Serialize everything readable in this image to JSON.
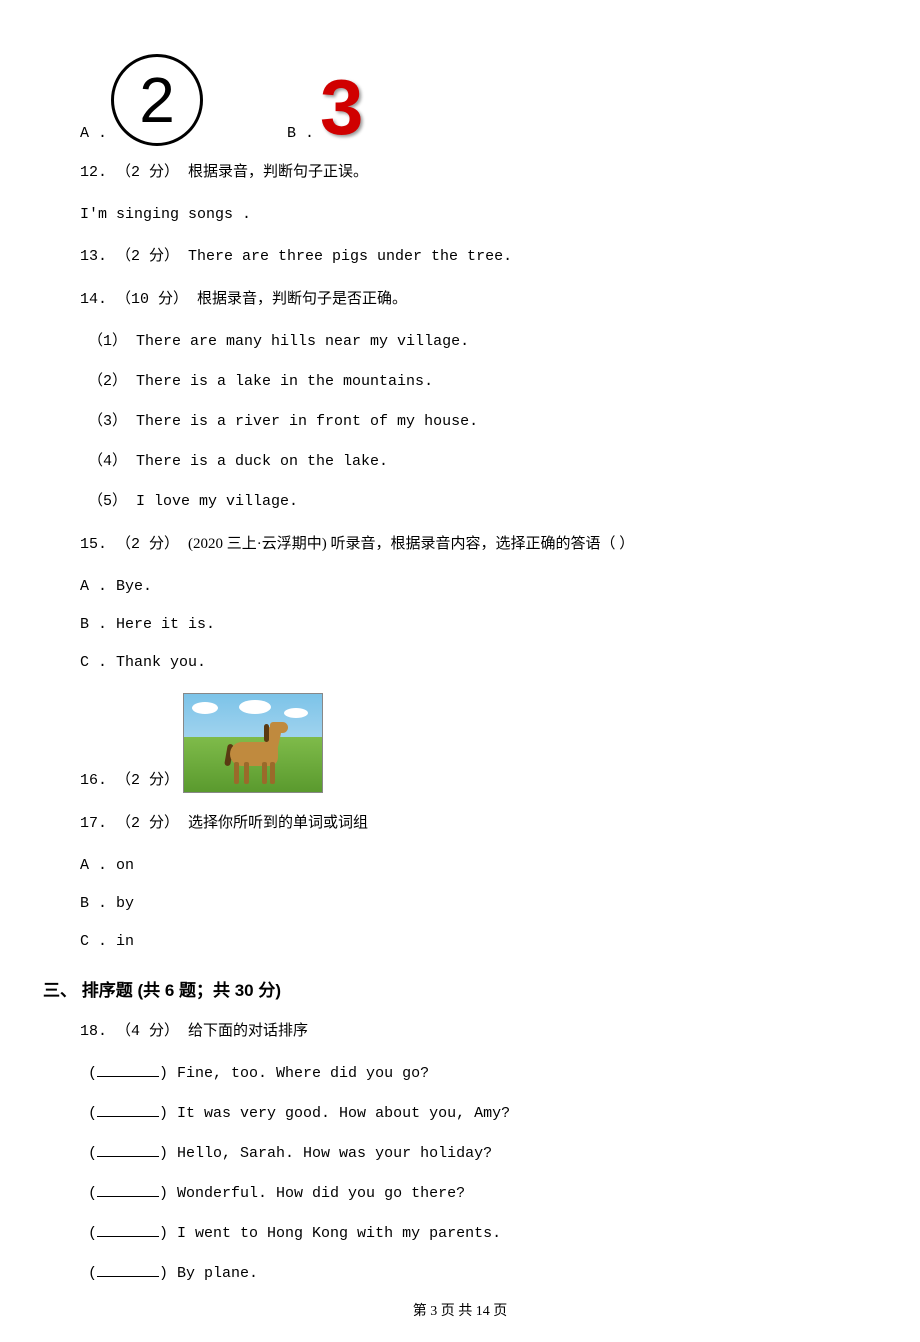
{
  "q11": {
    "optA": "A .",
    "optB": "B .",
    "imgA_value": "2",
    "imgB_value": "3"
  },
  "q12": {
    "prefix": "12. （2 分） ",
    "instruction": "根据录音，判断句子正误。",
    "sentence": "I'm singing songs ."
  },
  "q13": {
    "prefix": "13. （2 分） ",
    "text": "There are three pigs under the tree."
  },
  "q14": {
    "prefix": "14. （10 分） ",
    "instruction": "根据录音，判断句子是否正确。",
    "items": [
      {
        "label": "（1） ",
        "text": "There are many hills near my village."
      },
      {
        "label": "（2） ",
        "text": "There is a lake in the mountains."
      },
      {
        "label": "（3） ",
        "text": "There is a river in front of my house."
      },
      {
        "label": "（4） ",
        "text": "There is a duck on the lake."
      },
      {
        "label": "（5） ",
        "text": "I love my village."
      }
    ]
  },
  "q15": {
    "prefix": "15. （2 分） ",
    "meta": "(2020 三上·云浮期中) ",
    "instruction": "听录音，根据录音内容，选择正确的答语（    ）",
    "options": [
      {
        "label": "A . ",
        "text": "Bye."
      },
      {
        "label": "B . ",
        "text": "Here it is."
      },
      {
        "label": "C . ",
        "text": "Thank you."
      }
    ]
  },
  "q16": {
    "prefix": "16. （2 分）",
    "image_desc": "horse"
  },
  "q17": {
    "prefix": "17. （2 分） ",
    "instruction": "选择你所听到的单词或词组",
    "options": [
      {
        "label": "A . ",
        "text": "on"
      },
      {
        "label": "B . ",
        "text": "by"
      },
      {
        "label": "C . ",
        "text": "in"
      }
    ]
  },
  "section3": {
    "title": "三、 排序题 (共 6 题；共 30 分)"
  },
  "q18": {
    "prefix": "18. （4 分） ",
    "instruction": "给下面的对话排序",
    "lines": [
      "Fine, too. Where did you go?",
      "It was very good. How about you, Amy?",
      "Hello, Sarah. How was your holiday?",
      "Wonderful. How did you go there?",
      "I went to Hong Kong with my parents.",
      "By plane."
    ]
  },
  "footer": "第 3 页 共 14 页"
}
